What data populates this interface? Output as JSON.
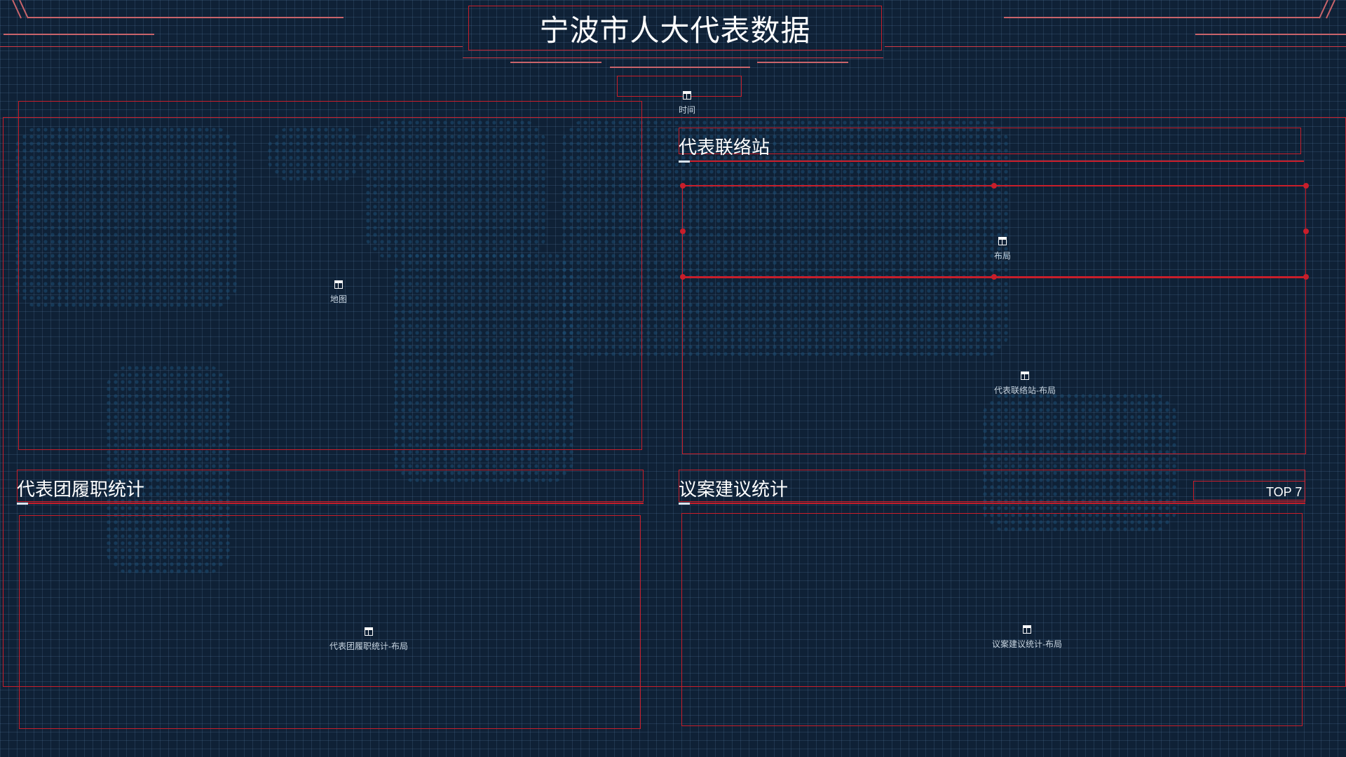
{
  "page": {
    "title": "宁波市人大代表数据",
    "time_label": "时间"
  },
  "panels": {
    "map": {
      "label": "地图"
    },
    "station": {
      "title": "代表联络站",
      "layout_label": "布局",
      "content_label": "代表联络站-布局"
    },
    "group_stats": {
      "title": "代表团履职统计",
      "content_label": "代表团履职统计-布局"
    },
    "proposal_stats": {
      "title": "议案建议统计",
      "badge": "TOP 7",
      "content_label": "议案建议统计-布局"
    }
  },
  "icons": {
    "placeholder": "table-icon"
  },
  "colors": {
    "background": "#0f2136",
    "accent_red": "#c81e2a",
    "grid": "#5a82aa"
  }
}
